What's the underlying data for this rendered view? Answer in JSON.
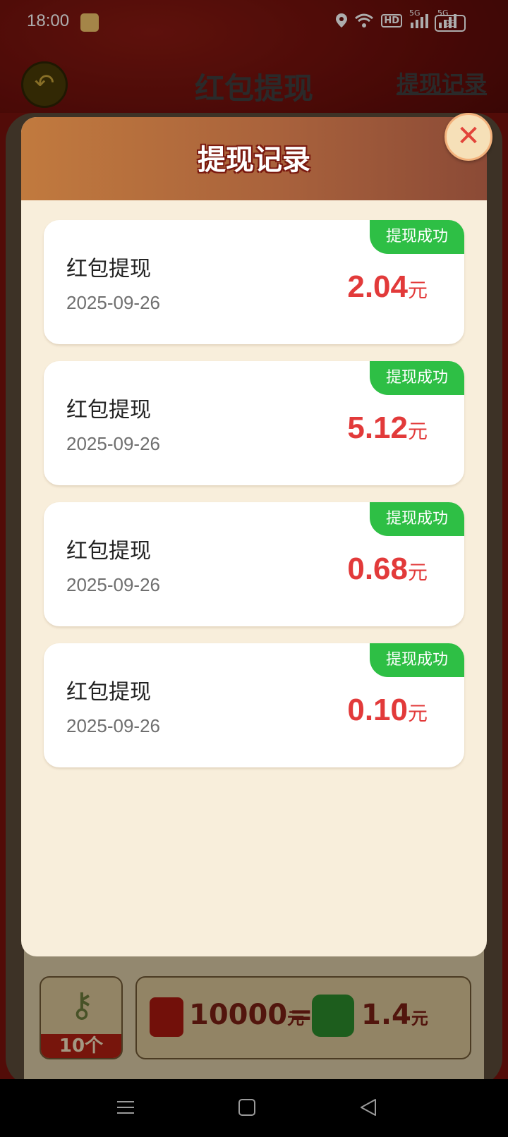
{
  "status_bar": {
    "time": "18:00",
    "network_hd": "HD",
    "signal_1": "5G",
    "signal_2": "5G",
    "battery": "95"
  },
  "header": {
    "title": "红包提现",
    "records_link": "提现记录"
  },
  "background_rate_row": {
    "reward_count": "10个",
    "red_packet_amount": "10000",
    "red_packet_unit": "元",
    "equals": "=",
    "cash_amount": "1.4",
    "cash_unit": "元"
  },
  "modal": {
    "title": "提现记录",
    "records": [
      {
        "title": "红包提现",
        "date": "2025-09-26",
        "amount": "2.04",
        "unit": "元",
        "status": "提现成功"
      },
      {
        "title": "红包提现",
        "date": "2025-09-26",
        "amount": "5.12",
        "unit": "元",
        "status": "提现成功"
      },
      {
        "title": "红包提现",
        "date": "2025-09-26",
        "amount": "0.68",
        "unit": "元",
        "status": "提现成功"
      },
      {
        "title": "红包提现",
        "date": "2025-09-26",
        "amount": "0.10",
        "unit": "元",
        "status": "提现成功"
      }
    ]
  },
  "colors": {
    "status_success": "#2ebf45",
    "amount": "#e23a3a",
    "modal_header": "#a9623c",
    "modal_bg": "#f8eedb"
  },
  "icons": {
    "back": "back-arrow-icon",
    "close": "close-icon",
    "nav_menu": "menu-icon",
    "nav_home": "home-icon",
    "nav_back": "back-triangle-icon"
  }
}
